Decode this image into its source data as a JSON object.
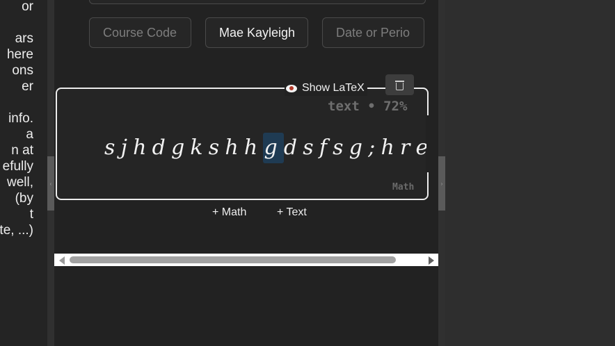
{
  "left_panel": {
    "text_lines": "or\n\nars\nhere\nons\ner\n\ninfo.\na\nn at\nefully\nwell,\n(by\nt\nte, ...)"
  },
  "header_fields": {
    "course_code_placeholder": "Course Code",
    "student_name_value": "Mae Kayleigh",
    "date_placeholder": "Date or Perio"
  },
  "editor": {
    "show_latex_label": "Show LaTeX",
    "mode_label": "text • 72%",
    "corner_label": "Math",
    "content_before": "sjhdgkshh",
    "content_highlight": "g",
    "content_after": "dsfsg;hreug"
  },
  "add_buttons": {
    "math_label": "+ Math",
    "text_label": "+ Text"
  }
}
